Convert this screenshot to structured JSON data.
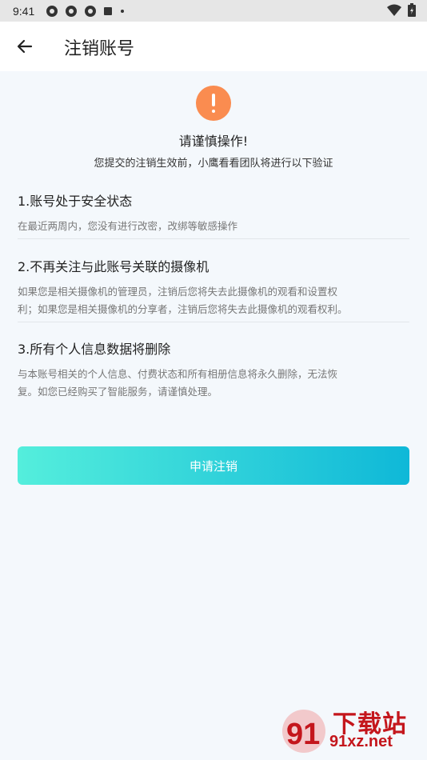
{
  "status_bar": {
    "time": "9:41"
  },
  "header": {
    "title": "注销账号"
  },
  "notice": {
    "caution": "请谨慎操作!",
    "subtitle": "您提交的注销生效前，小鹰看看团队将进行以下验证"
  },
  "sections": [
    {
      "title": "1.账号处于安全状态",
      "desc": "在最近两周内，您没有进行改密，改绑等敏感操作"
    },
    {
      "title": "2.不再关注与此账号关联的摄像机",
      "desc_line1": "如果您是相关摄像机的管理员，注销后您将失去此摄像机的观看和设置权",
      "desc_line2": "利；如果您是相关摄像机的分享者，注销后您将失去此摄像机的观看权利。"
    },
    {
      "title": "3.所有个人信息数据将删除",
      "desc_line1": "与本账号相关的个人信息、付费状态和所有相册信息将永久删除，无法恢",
      "desc_line2": "复。如您已经购买了智能服务，请谨慎处理。"
    }
  ],
  "apply_button": {
    "label": "申请注销"
  },
  "watermark": {
    "title": "下载站",
    "url": "91xz.net"
  },
  "colors": {
    "accent_start": "#54eedc",
    "accent_end": "#0fb8d8",
    "warning": "#fa8c50",
    "background": "#f4f8fc"
  },
  "icons": [
    "back-arrow-icon",
    "warning-icon",
    "wifi-icon",
    "battery-icon"
  ]
}
